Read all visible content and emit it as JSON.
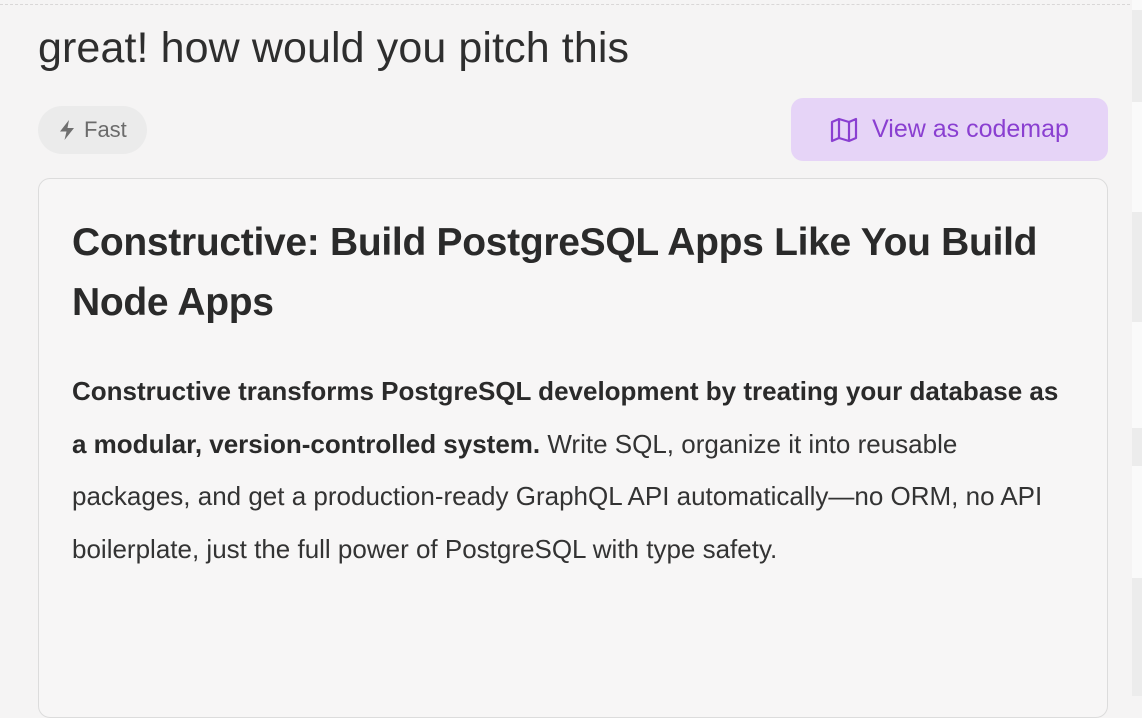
{
  "message": {
    "prompt": "great! how would you pitch this"
  },
  "mode_chip": {
    "icon": "lightning-bolt-icon",
    "label": "Fast"
  },
  "codemap_button": {
    "icon": "map-icon",
    "label": "View as codemap"
  },
  "response": {
    "title": "Constructive: Build PostgreSQL Apps Like You Build Node Apps",
    "lead_bold": "Constructive transforms PostgreSQL development by treating your database as a modular, version-controlled system.",
    "lead_rest": " Write SQL, organize it into reusable packages, and get a production-ready GraphQL API automatically—no ORM, no API boilerplate, just the full power of PostgreSQL with type safety."
  },
  "colors": {
    "accent_purple": "#8a3fd1",
    "accent_purple_bg": "#e6d4f7",
    "chip_bg": "#ebebeb",
    "page_bg": "#f5f4f4"
  }
}
